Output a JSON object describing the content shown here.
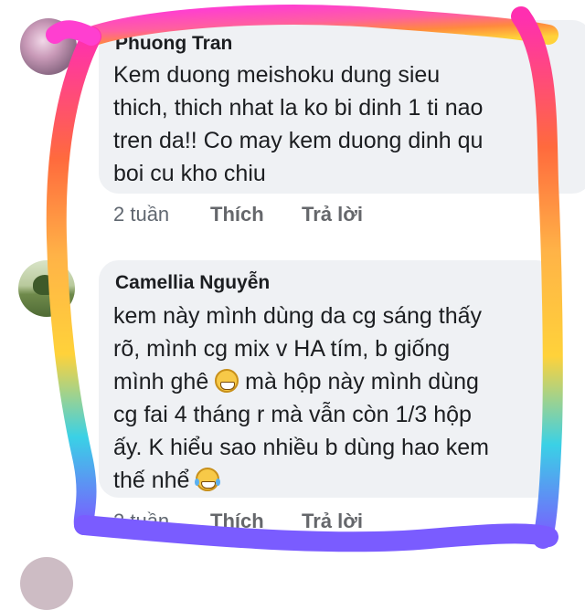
{
  "comments": [
    {
      "author": "Phuong Tran",
      "lines": [
        "Kem duong meishoku dung sieu",
        "thich, thich nhat la ko bi dinh 1 ti nao",
        "tren da!! Co may kem duong dinh qu",
        "boi cu kho chiu"
      ],
      "time": "2 tuần",
      "like_label": "Thích",
      "reply_label": "Trả lời"
    },
    {
      "author": "Camellia Nguyễn",
      "lines": [
        "kem này mình dùng da cg sáng thấy",
        "rõ, mình cg mix v HA tím, b giống",
        "mình ghê",
        " mà hộp này mình dùng",
        "cg fai 4 tháng r mà vẫn còn 1/3 hộp",
        "ấy. K hiểu sao nhiều b dùng hao kem",
        "thế nhể"
      ],
      "emojis": [
        "grimacing-face-emoji",
        "tears-of-joy-emoji"
      ],
      "time": "2 tuần",
      "like_label": "Thích",
      "reply_label": "Trả lời"
    }
  ],
  "colors": {
    "bubble": "#eff1f4",
    "ring_gradient": [
      "#ff2fb0",
      "#ff6a3d",
      "#ffd23a",
      "#3ad1e6",
      "#7a5cff",
      "#ff3fd0"
    ]
  }
}
